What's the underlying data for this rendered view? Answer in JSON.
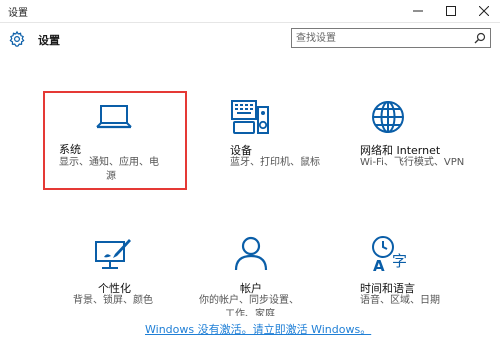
{
  "window": {
    "title": "设置",
    "controls": [
      "minimize-icon",
      "maximize-icon",
      "close-icon"
    ]
  },
  "header": {
    "title": "设置",
    "icon": "gear-icon",
    "search": {
      "placeholder": "查找设置",
      "value": "",
      "icon": "search-icon"
    }
  },
  "tiles": [
    {
      "name": "系统",
      "desc_line1": "显示、通知、应用、电",
      "desc_line2": "源",
      "icon": "laptop-icon",
      "selected": true
    },
    {
      "name": "设备",
      "desc_line1": "蓝牙、打印机、鼠标",
      "icon": "devices-icon"
    },
    {
      "name": "网络和 Internet",
      "desc_line1": "Wi-Fi、飞行模式、VPN",
      "icon": "globe-icon"
    },
    {
      "name": "个性化",
      "desc_line1": "背景、锁屏、颜色",
      "icon": "personalization-icon"
    },
    {
      "name": "帐户",
      "desc_line1": "你的帐户、同步设置、",
      "desc_line2": "工作、家庭",
      "icon": "account-icon"
    },
    {
      "name": "时间和语言",
      "desc_line1": "语音、区域、日期",
      "icon": "time-language-icon"
    }
  ],
  "activation_link": "Windows 没有激活。请立即激活 Windows。",
  "colors": {
    "accent": "#1f7fd6",
    "icon": "#0a5ea8",
    "selection_border": "#e53935"
  }
}
